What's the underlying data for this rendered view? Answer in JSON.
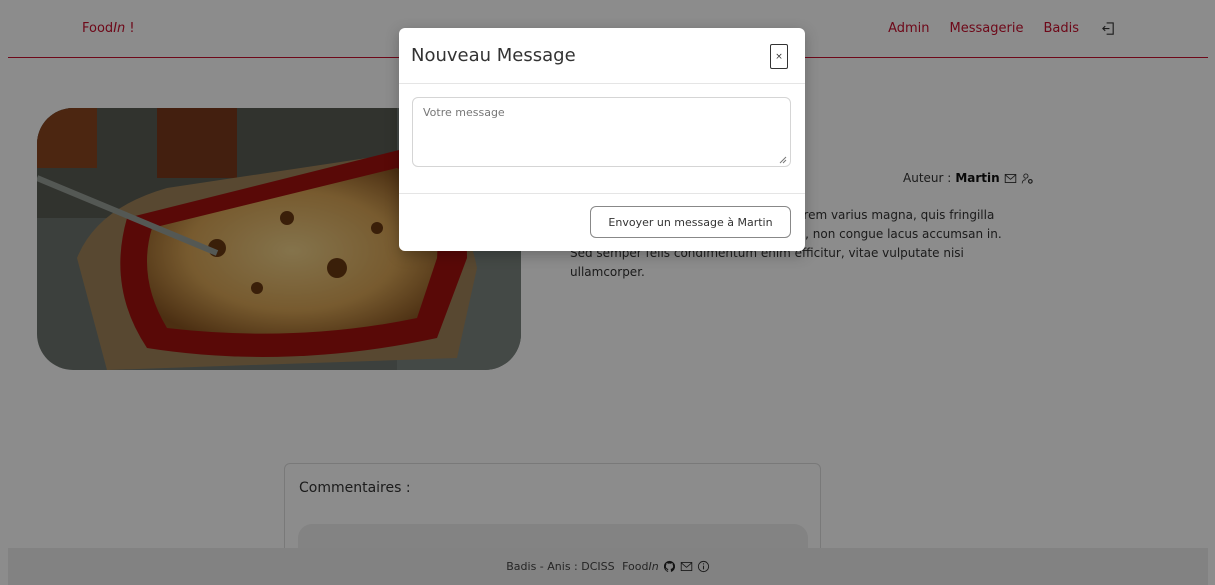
{
  "navbar": {
    "brand_prefix": "Food",
    "brand_italic": "In",
    "brand_suffix": " !",
    "links": [
      "Admin",
      "Messagerie",
      "Badis"
    ],
    "logout_icon": "logout-icon"
  },
  "recipe": {
    "author_label": "Auteur :",
    "author_name": "Martin",
    "author_icons": [
      "envelope-icon",
      "user-gear-icon"
    ],
    "description_visible": "a in, aliquet nec orci. Vivamus tortor lorem varius magna, quis fringilla neque enim a risus. Duis mattis leo elit, non congue lacus accumsan in. Sed semper felis condimentum enim efficitur, vitae vulputate nisi ullamcorper."
  },
  "comments": {
    "title": "Commentaires :"
  },
  "footer": {
    "text": "Badis - Anis : DCISS",
    "brand_prefix": "Food",
    "brand_italic": "In",
    "icons": [
      "github-icon",
      "envelope-icon",
      "info-icon"
    ]
  },
  "modal": {
    "title": "Nouveau Message",
    "close_label": "×",
    "message_placeholder": "Votre message",
    "send_label": "Envoyer un message à Martin"
  },
  "colors": {
    "brand_red": "#c8102e",
    "overlay": "rgba(0,0,0,0.45)"
  }
}
